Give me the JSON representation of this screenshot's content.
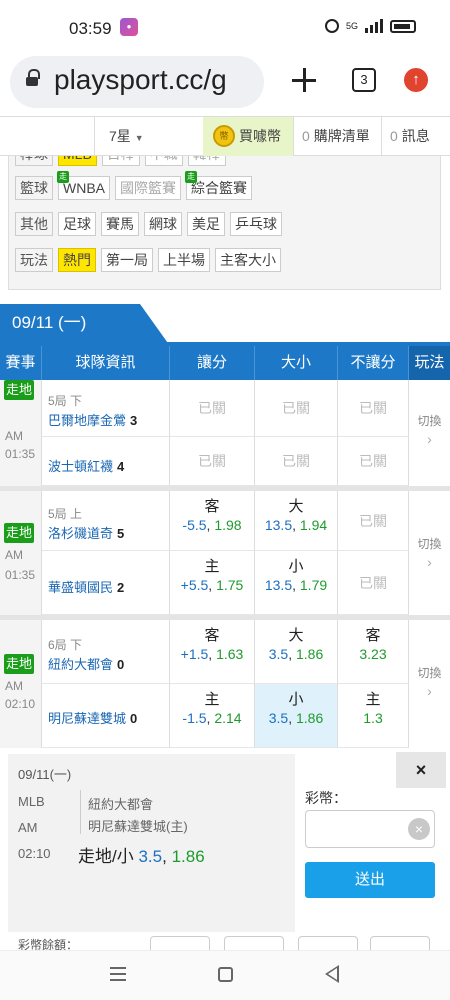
{
  "status_bar": {
    "time": "03:59",
    "network": "5G"
  },
  "browser": {
    "url": "playsport.cc/g",
    "tab_count": "3"
  },
  "site_bar": {
    "star_select": "7星",
    "buy_label": "買噱幣",
    "cart_count": "0",
    "cart_label": "購牌清單",
    "msg_count": "0",
    "msg_label": "訊息"
  },
  "filters": {
    "partial_row": [
      "棒球",
      "MLB",
      "日棒",
      "中職",
      "韓棒"
    ],
    "basketball": {
      "label": "籃球",
      "items": [
        "WNBA",
        "國際籃賽",
        "綜合籃賽"
      ]
    },
    "others": {
      "label": "其他",
      "items": [
        "足球",
        "賽馬",
        "網球",
        "美足",
        "乒乓球"
      ]
    },
    "play": {
      "label": "玩法",
      "items": [
        "熱門",
        "第一局",
        "上半場",
        "主客大小"
      ]
    }
  },
  "date_tab": "09/11 (一)",
  "table_headers": [
    "賽事",
    "球隊資訊",
    "讓分",
    "大小",
    "不讓分",
    "玩法"
  ],
  "games": [
    {
      "live": "走地",
      "ampm": "AM",
      "time": "01:35",
      "inning": "5局 下",
      "away": {
        "name": "巴爾地摩金鶯",
        "score": "3"
      },
      "home": {
        "name": "波士頓紅襪",
        "score": "4"
      },
      "closed": "已關",
      "switch": "切換"
    },
    {
      "live": "走地",
      "ampm": "AM",
      "time": "01:35",
      "inning": "5局 上",
      "away": {
        "name": "洛杉磯道奇",
        "score": "5"
      },
      "home": {
        "name": "華盛頓國民",
        "score": "2"
      },
      "spread": {
        "away": {
          "side": "客",
          "line": "-5.5",
          "price": "1.98"
        },
        "home": {
          "side": "主",
          "line": "+5.5",
          "price": "1.75"
        }
      },
      "total": {
        "over": {
          "side": "大",
          "line": "13.5",
          "price": "1.94"
        },
        "under": {
          "side": "小",
          "line": "13.5",
          "price": "1.79"
        }
      },
      "closed": "已關",
      "switch": "切換"
    },
    {
      "live": "走地",
      "ampm": "AM",
      "time": "02:10",
      "inning": "6局 下",
      "away": {
        "name": "紐約大都會",
        "score": "0"
      },
      "home": {
        "name": "明尼蘇達雙城",
        "score": "0"
      },
      "spread": {
        "away": {
          "side": "客",
          "line": "+1.5",
          "price": "1.63"
        },
        "home": {
          "side": "主",
          "line": "-1.5",
          "price": "2.14"
        }
      },
      "total": {
        "over": {
          "side": "大",
          "line": "3.5",
          "price": "1.86"
        },
        "under": {
          "side": "小",
          "line": "3.5",
          "price": "1.86"
        }
      },
      "moneyline": {
        "away": {
          "side": "客",
          "price": "3.23"
        },
        "home": {
          "side": "主",
          "price": "1.3"
        }
      },
      "switch": "切換"
    }
  ],
  "bet_slip": {
    "date": "09/11(一)",
    "league": "MLB",
    "ampm": "AM",
    "time": "02:10",
    "away_team": "紐約大都會",
    "home_team": "明尼蘇達雙城(主)",
    "pick_prefix": "走地/小",
    "pick_line": "3.5",
    "pick_price": "1.86",
    "amount_label": "彩幣：",
    "amount_value": "",
    "submit_label": "送出",
    "close_label": "×",
    "sum_label": "彩幣餘額："
  }
}
